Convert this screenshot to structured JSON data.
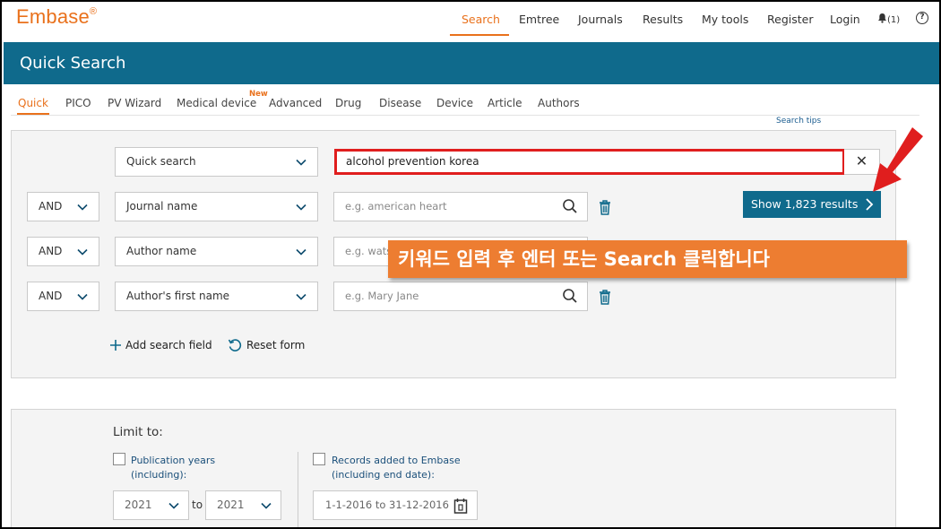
{
  "logo": {
    "text": "Embase",
    "mark": "®"
  },
  "nav": {
    "items": [
      {
        "label": "Search"
      },
      {
        "label": "Emtree"
      },
      {
        "label": "Journals"
      },
      {
        "label": "Results"
      },
      {
        "label": "My tools"
      },
      {
        "label": "Register"
      },
      {
        "label": "Login"
      }
    ],
    "notifications": "(1)",
    "help": "?"
  },
  "header": {
    "title": "Quick Search"
  },
  "tabs": {
    "items": [
      {
        "label": "Quick"
      },
      {
        "label": "PICO"
      },
      {
        "label": "PV Wizard"
      },
      {
        "label": "Medical device"
      },
      {
        "label": "Advanced"
      },
      {
        "label": "Drug"
      },
      {
        "label": "Disease"
      },
      {
        "label": "Device"
      },
      {
        "label": "Article"
      },
      {
        "label": "Authors"
      }
    ],
    "new_badge": "New",
    "search_tips": "Search tips"
  },
  "search": {
    "primary_field": "Quick search",
    "primary_value": "alcohol prevention korea",
    "clear": "✕",
    "rows": [
      {
        "operator": "AND",
        "field": "Journal name",
        "placeholder": "e.g. american heart"
      },
      {
        "operator": "AND",
        "field": "Author name",
        "placeholder": "e.g. wats"
      },
      {
        "operator": "AND",
        "field": "Author's first name",
        "placeholder": "e.g. Mary Jane"
      }
    ],
    "show_results": "Show 1,823 results",
    "add_field": "Add search field",
    "reset_form": "Reset form"
  },
  "callout": {
    "text": "키워드 입력 후 엔터 또는 Search 클릭합니다"
  },
  "limits": {
    "title": "Limit to:",
    "pub_years_label_1": "Publication years",
    "pub_years_label_2": "(including):",
    "records_label_1": "Records added to Embase",
    "records_label_2": "(including end date):",
    "year_from": "2021",
    "year_to": "2021",
    "to": "to",
    "date_range": "1-1-2016 to 31-12-2016"
  },
  "colors": {
    "accent": "#e9711c",
    "brand_blue": "#0f6a8c",
    "highlight_red": "#e01e1e",
    "callout_orange": "#ed7d31"
  }
}
